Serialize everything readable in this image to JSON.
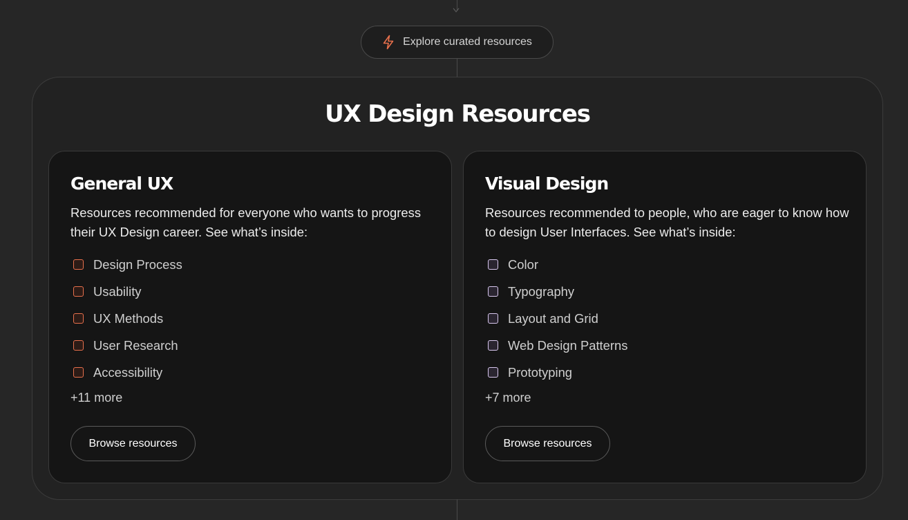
{
  "colors": {
    "background": "#262626",
    "accent_orange": "#e8704c",
    "accent_purple": "#d9c8ef",
    "card_background": "#151515"
  },
  "banner": {
    "icon": "lightning-bolt-icon",
    "label": "Explore curated resources"
  },
  "section": {
    "title": "UX Design Resources"
  },
  "cards": [
    {
      "title": "General UX",
      "description": "Resources recommended for everyone who wants to progress their UX Design career. See what’s inside:",
      "items": [
        "Design Process",
        "Usability",
        "UX Methods",
        "User Research",
        "Accessibility"
      ],
      "more": "+11 more",
      "button": "Browse resources"
    },
    {
      "title": "Visual Design",
      "description": "Resources recommended to people, who are eager to know how to design User Interfaces. See what’s inside:",
      "items": [
        "Color",
        "Typography",
        "Layout and Grid",
        "Web Design Patterns",
        "Prototyping"
      ],
      "more": "+7 more",
      "button": "Browse resources"
    }
  ]
}
